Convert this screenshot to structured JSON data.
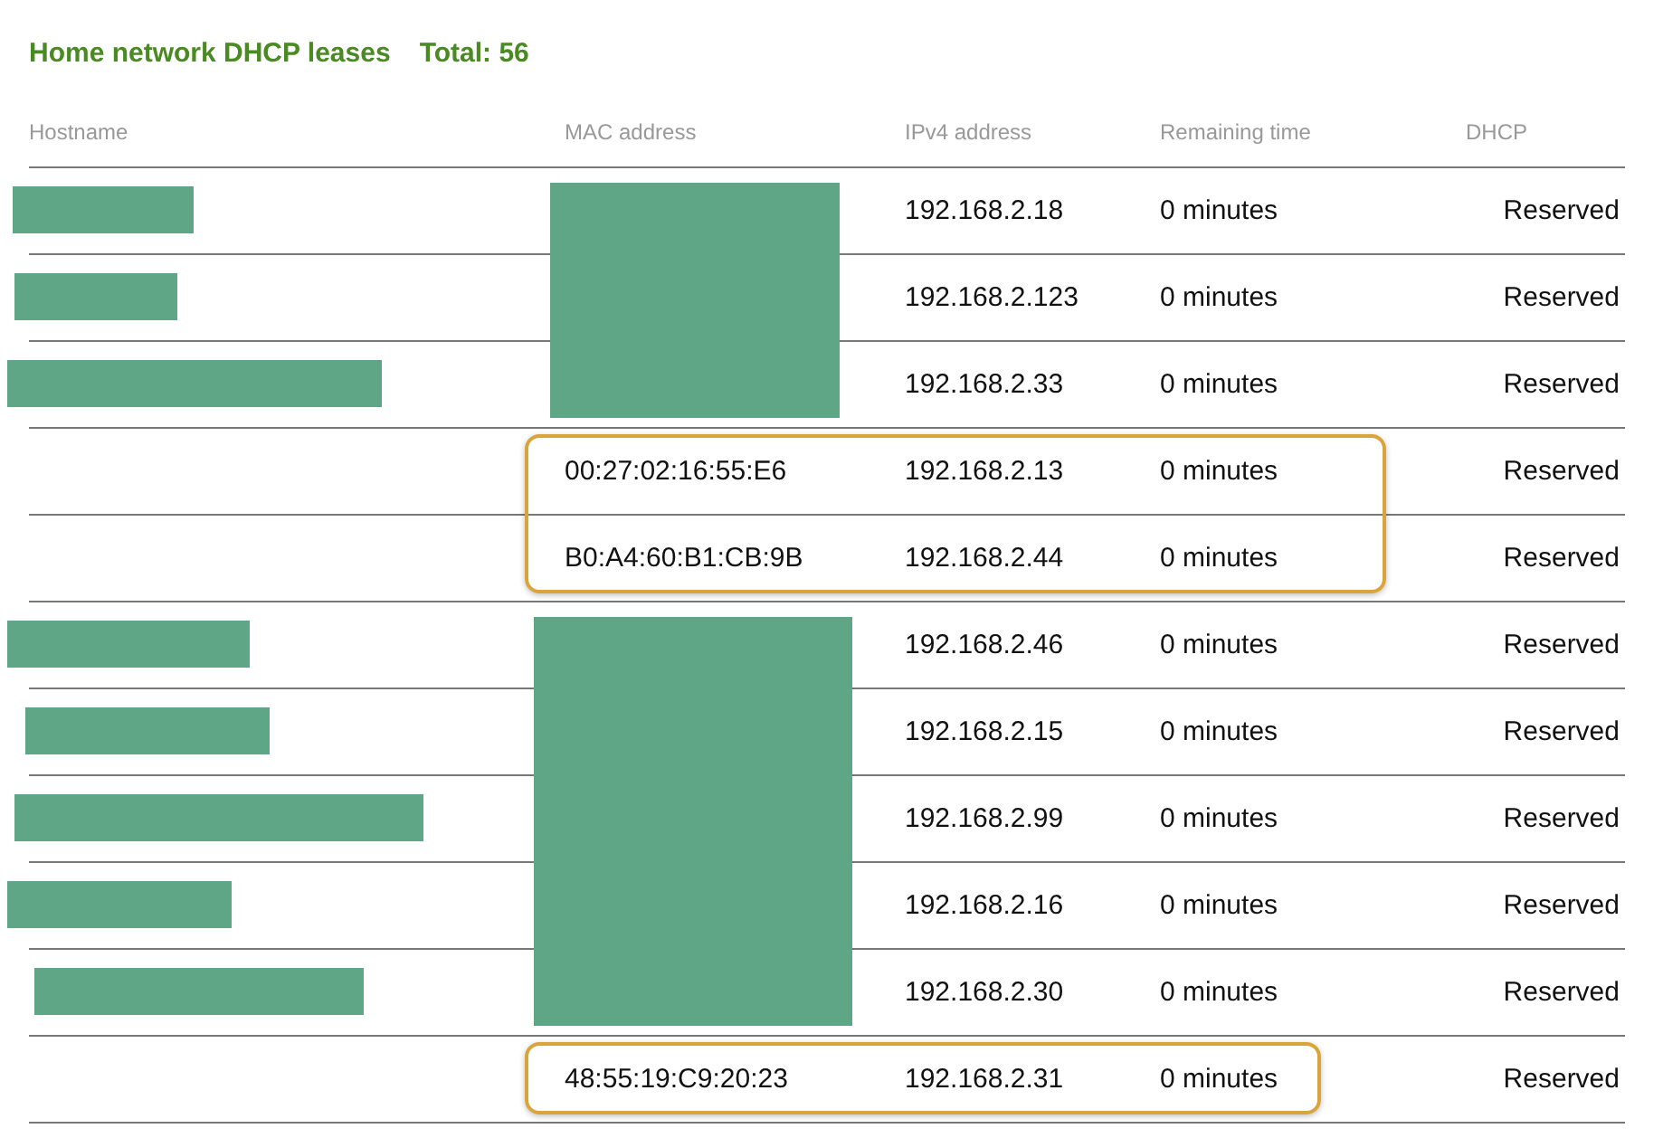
{
  "title": "Home network DHCP leases",
  "total": "Total: 56",
  "columns": [
    "Hostname",
    "MAC address",
    "IPv4 address",
    "Remaining time",
    "DHCP"
  ],
  "rows": [
    {
      "hostname_redacted": true,
      "mac_redacted": true,
      "mac": "",
      "ip": "192.168.2.18",
      "remaining": "0 minutes",
      "dhcp": "Reserved",
      "highlighted": false
    },
    {
      "hostname_redacted": true,
      "mac_redacted": true,
      "mac": "",
      "ip": "192.168.2.123",
      "remaining": "0 minutes",
      "dhcp": "Reserved",
      "highlighted": false
    },
    {
      "hostname_redacted": true,
      "mac_redacted": true,
      "mac": "",
      "ip": "192.168.2.33",
      "remaining": "0 minutes",
      "dhcp": "Reserved",
      "highlighted": false
    },
    {
      "hostname_redacted": false,
      "mac_redacted": false,
      "mac": "00:27:02:16:55:E6",
      "ip": "192.168.2.13",
      "remaining": "0 minutes",
      "dhcp": "Reserved",
      "highlighted": true
    },
    {
      "hostname_redacted": false,
      "mac_redacted": false,
      "mac": "B0:A4:60:B1:CB:9B",
      "ip": "192.168.2.44",
      "remaining": "0 minutes",
      "dhcp": "Reserved",
      "highlighted": true
    },
    {
      "hostname_redacted": true,
      "mac_redacted": true,
      "mac": "",
      "ip": "192.168.2.46",
      "remaining": "0 minutes",
      "dhcp": "Reserved",
      "highlighted": false
    },
    {
      "hostname_redacted": true,
      "mac_redacted": true,
      "mac": "",
      "ip": "192.168.2.15",
      "remaining": "0 minutes",
      "dhcp": "Reserved",
      "highlighted": false
    },
    {
      "hostname_redacted": true,
      "mac_redacted": true,
      "mac": "",
      "ip": "192.168.2.99",
      "remaining": "0 minutes",
      "dhcp": "Reserved",
      "highlighted": false
    },
    {
      "hostname_redacted": true,
      "mac_redacted": true,
      "mac": "",
      "ip": "192.168.2.16",
      "remaining": "0 minutes",
      "dhcp": "Reserved",
      "highlighted": false
    },
    {
      "hostname_redacted": true,
      "mac_redacted": true,
      "mac": "",
      "ip": "192.168.2.30",
      "remaining": "0 minutes",
      "dhcp": "Reserved",
      "highlighted": false
    },
    {
      "hostname_redacted": false,
      "mac_redacted": false,
      "mac": "48:55:19:C9:20:23",
      "ip": "192.168.2.31",
      "remaining": "0 minutes",
      "dhcp": "Reserved",
      "highlighted": true
    }
  ]
}
